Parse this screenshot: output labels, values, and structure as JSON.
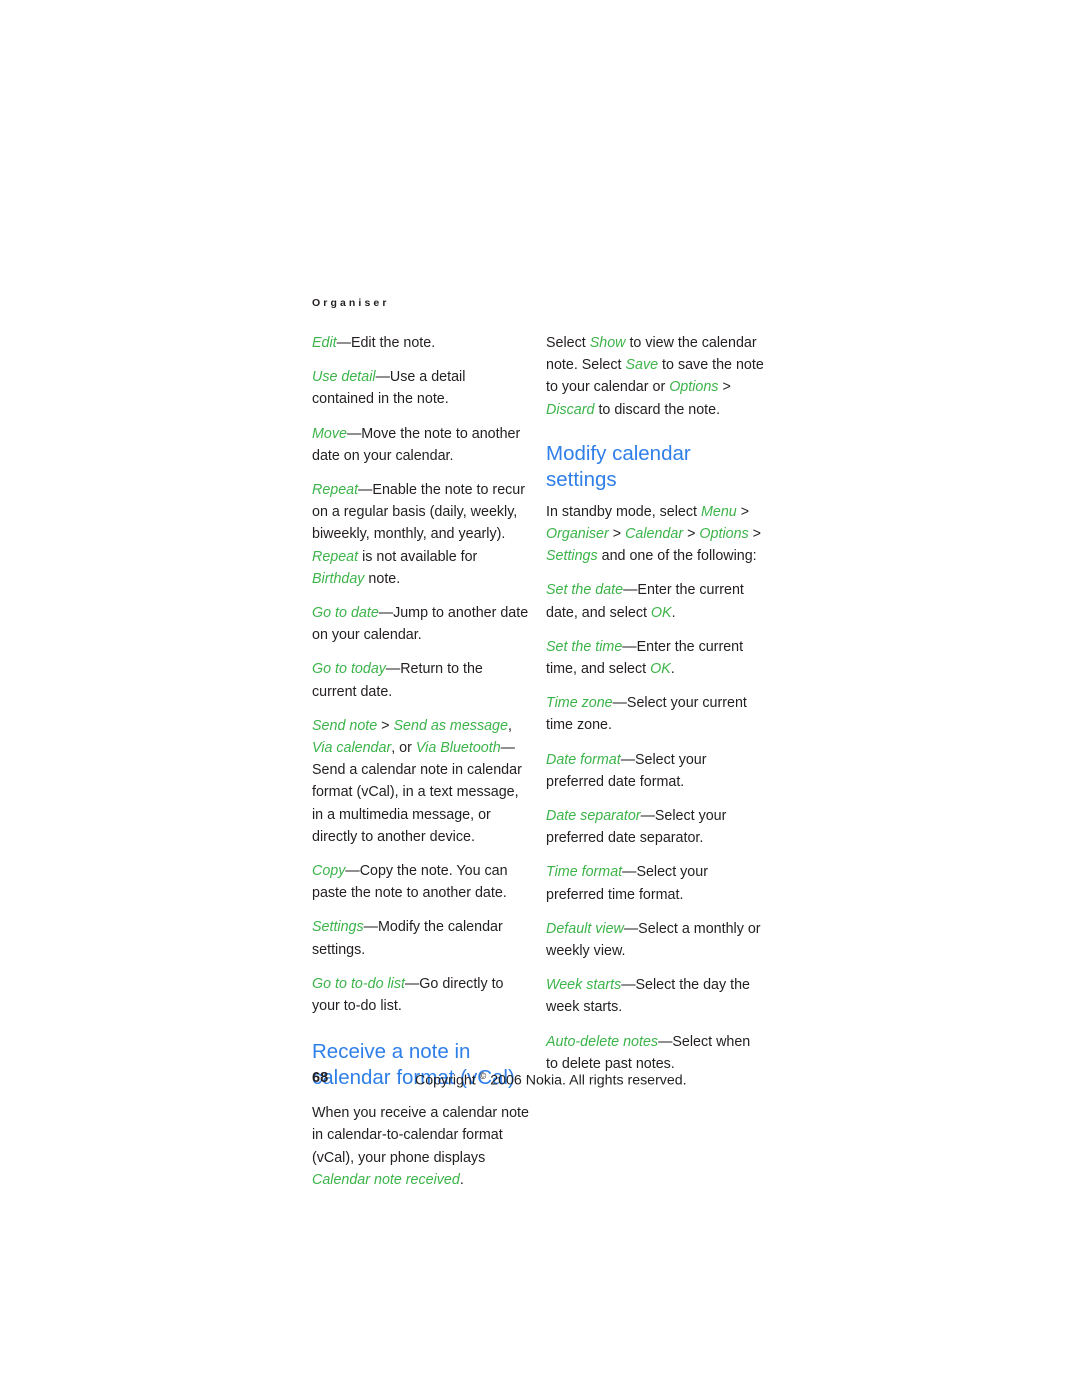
{
  "running_head": "Organiser",
  "left_column": {
    "paragraphs": [
      [
        {
          "t": "Edit",
          "s": "hl"
        },
        {
          "t": "—Edit the note.",
          "s": "plain"
        }
      ],
      [
        {
          "t": "Use detail",
          "s": "hl"
        },
        {
          "t": "—Use a detail contained in the note.",
          "s": "plain"
        }
      ],
      [
        {
          "t": "Move",
          "s": "hl"
        },
        {
          "t": "—Move the note to another date on your calendar.",
          "s": "plain"
        }
      ],
      [
        {
          "t": "Repeat",
          "s": "hl"
        },
        {
          "t": "—Enable the note to recur on a regular basis (daily, weekly, biweekly, monthly, and yearly). ",
          "s": "plain"
        },
        {
          "t": "Repeat",
          "s": "hl"
        },
        {
          "t": " is not available for ",
          "s": "plain"
        },
        {
          "t": "Birthday",
          "s": "hl"
        },
        {
          "t": " note.",
          "s": "plain"
        }
      ],
      [
        {
          "t": "Go to date",
          "s": "hl"
        },
        {
          "t": "—Jump to another date on your calendar.",
          "s": "plain"
        }
      ],
      [
        {
          "t": "Go to today",
          "s": "hl"
        },
        {
          "t": "—Return to the current date.",
          "s": "plain"
        }
      ],
      [
        {
          "t": "Send note",
          "s": "hl"
        },
        {
          "t": " > ",
          "s": "plain"
        },
        {
          "t": "Send as message",
          "s": "hl"
        },
        {
          "t": ", ",
          "s": "plain"
        },
        {
          "t": "Via calendar",
          "s": "hl"
        },
        {
          "t": ", or ",
          "s": "plain"
        },
        {
          "t": "Via Bluetooth",
          "s": "hl"
        },
        {
          "t": "—Send a calendar note in calendar format (vCal), in a text message, in a multimedia message, or directly to another device.",
          "s": "plain"
        }
      ],
      [
        {
          "t": "Copy",
          "s": "hl"
        },
        {
          "t": "—Copy the note. You can paste the note to another date.",
          "s": "plain"
        }
      ],
      [
        {
          "t": "Settings",
          "s": "hl"
        },
        {
          "t": "—Modify the calendar settings.",
          "s": "plain"
        }
      ],
      [
        {
          "t": "Go to to-do list",
          "s": "hl"
        },
        {
          "t": "—Go directly to your to-do list.",
          "s": "plain"
        }
      ]
    ],
    "heading": "Receive a note in calendar format (vCal)",
    "after_heading_paragraphs": [
      [
        {
          "t": "When you receive a calendar note in calendar-to-calendar format (vCal), your phone displays ",
          "s": "plain"
        },
        {
          "t": "Calendar note received",
          "s": "hl"
        },
        {
          "t": ".",
          "s": "plain"
        }
      ]
    ]
  },
  "right_column": {
    "paragraphs": [
      [
        {
          "t": "Select ",
          "s": "plain"
        },
        {
          "t": "Show",
          "s": "hl"
        },
        {
          "t": " to view the calendar note. Select ",
          "s": "plain"
        },
        {
          "t": "Save",
          "s": "hl"
        },
        {
          "t": " to save the note to your calendar or ",
          "s": "plain"
        },
        {
          "t": "Options",
          "s": "hl"
        },
        {
          "t": " > ",
          "s": "plain"
        },
        {
          "t": "Discard",
          "s": "hl"
        },
        {
          "t": " to discard the note.",
          "s": "plain"
        }
      ]
    ],
    "heading": "Modify calendar settings",
    "after_heading_paragraphs": [
      [
        {
          "t": "In standby mode, select ",
          "s": "plain"
        },
        {
          "t": "Menu",
          "s": "hl"
        },
        {
          "t": " > ",
          "s": "plain"
        },
        {
          "t": "Organiser",
          "s": "hl"
        },
        {
          "t": " > ",
          "s": "plain"
        },
        {
          "t": "Calendar",
          "s": "hl"
        },
        {
          "t": " > ",
          "s": "plain"
        },
        {
          "t": "Options",
          "s": "hl"
        },
        {
          "t": " > ",
          "s": "plain"
        },
        {
          "t": "Settings",
          "s": "hl"
        },
        {
          "t": " and one of the following:",
          "s": "plain"
        }
      ],
      [
        {
          "t": "Set the date",
          "s": "hl"
        },
        {
          "t": "—Enter the current date, and select ",
          "s": "plain"
        },
        {
          "t": "OK",
          "s": "hl"
        },
        {
          "t": ".",
          "s": "plain"
        }
      ],
      [
        {
          "t": "Set the time",
          "s": "hl"
        },
        {
          "t": "—Enter the current time, and select ",
          "s": "plain"
        },
        {
          "t": "OK",
          "s": "hl"
        },
        {
          "t": ".",
          "s": "plain"
        }
      ],
      [
        {
          "t": "Time zone",
          "s": "hl"
        },
        {
          "t": "—Select your current time zone.",
          "s": "plain"
        }
      ],
      [
        {
          "t": "Date format",
          "s": "hl"
        },
        {
          "t": "—Select your preferred date format.",
          "s": "plain"
        }
      ],
      [
        {
          "t": "Date separator",
          "s": "hl"
        },
        {
          "t": "—Select your preferred date separator.",
          "s": "plain"
        }
      ],
      [
        {
          "t": "Time format",
          "s": "hl"
        },
        {
          "t": "—Select your preferred time format.",
          "s": "plain"
        }
      ],
      [
        {
          "t": "Default view",
          "s": "hl"
        },
        {
          "t": "—Select a monthly or weekly view.",
          "s": "plain"
        }
      ],
      [
        {
          "t": "Week starts",
          "s": "hl"
        },
        {
          "t": "—Select the day the week starts.",
          "s": "plain"
        }
      ],
      [
        {
          "t": "Auto-delete notes",
          "s": "hl"
        },
        {
          "t": "—Select when to delete past notes.",
          "s": "plain"
        }
      ]
    ]
  },
  "footer": {
    "page_number": "68",
    "copyright_prefix": "Copyright ",
    "copyright_symbol": "©",
    "copyright_suffix": " 2006 Nokia. All rights reserved."
  },
  "colors": {
    "accent_green": "#3cb44a",
    "heading_blue": "#2f7fe8",
    "body_text": "#231f20",
    "page_background": "#ffffff"
  }
}
